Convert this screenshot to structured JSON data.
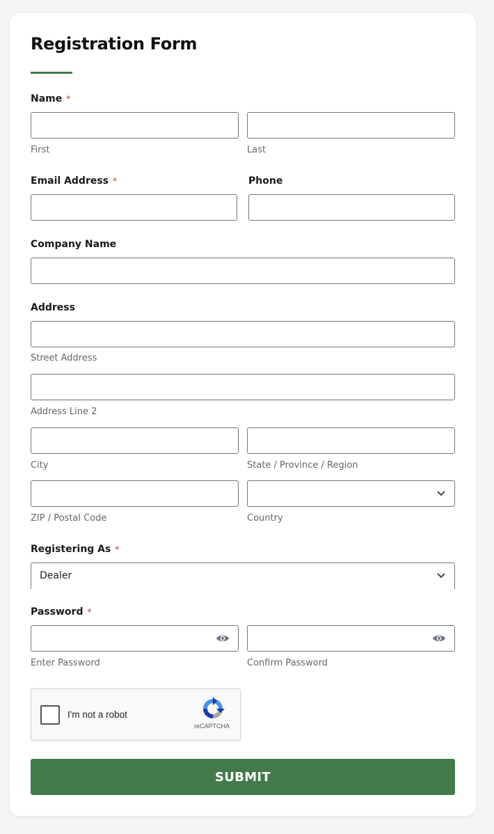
{
  "form": {
    "title": "Registration Form",
    "accent_color": "#447a4a",
    "required_marker": "*"
  },
  "name": {
    "label": "Name",
    "first_sub": "First",
    "last_sub": "Last",
    "first_value": "",
    "last_value": ""
  },
  "email": {
    "label": "Email Address",
    "value": ""
  },
  "phone": {
    "label": "Phone",
    "value": ""
  },
  "company": {
    "label": "Company Name",
    "value": ""
  },
  "address": {
    "label": "Address",
    "street_sub": "Street Address",
    "line2_sub": "Address Line 2",
    "city_sub": "City",
    "state_sub": "State / Province / Region",
    "zip_sub": "ZIP / Postal Code",
    "country_sub": "Country",
    "country_value": ""
  },
  "registering_as": {
    "label": "Registering As",
    "value": "Dealer"
  },
  "password": {
    "label": "Password",
    "enter_sub": "Enter Password",
    "confirm_sub": "Confirm Password",
    "icon": "eye-icon"
  },
  "captcha": {
    "label": "I'm not a robot",
    "brand": "reCAPTCHA",
    "checked": false
  },
  "submit": {
    "label": "SUBMIT"
  }
}
